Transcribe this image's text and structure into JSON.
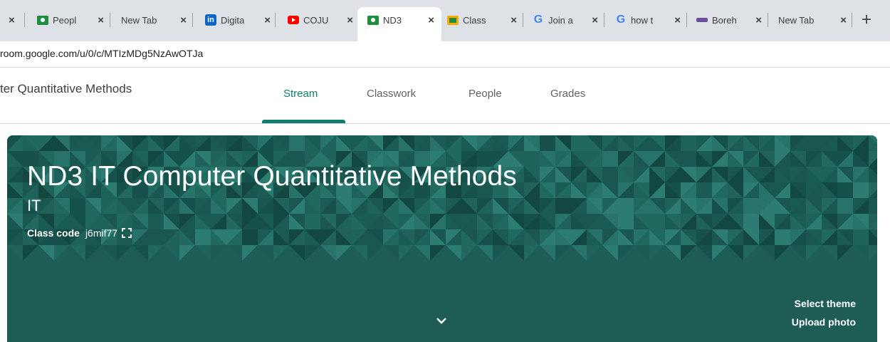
{
  "browser": {
    "tabs": [
      {
        "title": "",
        "favicon": "none"
      },
      {
        "title": "Peopl",
        "favicon": "classroom-icon"
      },
      {
        "title": "New Tab",
        "favicon": "none"
      },
      {
        "title": "Digita",
        "favicon": "linkedin-icon"
      },
      {
        "title": "COJU",
        "favicon": "youtube-icon"
      },
      {
        "title": "ND3",
        "favicon": "classroom-icon",
        "active": true
      },
      {
        "title": "Class",
        "favicon": "classroom-icon"
      },
      {
        "title": "Join a",
        "favicon": "google-icon"
      },
      {
        "title": "how t",
        "favicon": "google-icon"
      },
      {
        "title": "Boreh",
        "favicon": "site-icon"
      },
      {
        "title": "New Tab",
        "favicon": "none"
      }
    ],
    "close_glyph": "×",
    "new_tab_glyph": "+",
    "url": "room.google.com/u/0/c/MTIzMDg5NzAwOTJa"
  },
  "app": {
    "course_title_short": "ter Quantitative Methods",
    "nav": [
      {
        "label": "Stream",
        "active": true
      },
      {
        "label": "Classwork",
        "active": false
      },
      {
        "label": "People",
        "active": false
      },
      {
        "label": "Grades",
        "active": false
      }
    ]
  },
  "banner": {
    "title": "ND3 IT Computer Quantitative Methods",
    "section": "IT",
    "class_code_label": "Class code",
    "class_code": "j6mif77",
    "select_theme": "Select theme",
    "upload_photo": "Upload photo"
  },
  "colors": {
    "accent": "#137d6b",
    "banner": "#1d5d55",
    "tabstrip": "#dee1e6"
  }
}
